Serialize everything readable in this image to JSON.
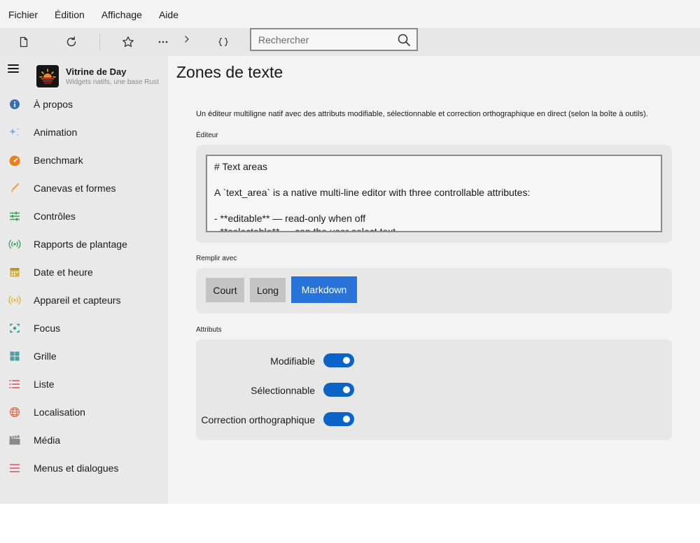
{
  "menubar": {
    "items": [
      "Fichier",
      "Édition",
      "Affichage",
      "Aide"
    ]
  },
  "toolbar": {
    "buttons": [
      "new-document-icon",
      "refresh-icon",
      "star-icon",
      "more-icon",
      "chevron-right-icon",
      "braces-icon"
    ],
    "search_placeholder": "Rechercher"
  },
  "sidebar": {
    "app_title": "Vitrine de Day",
    "app_subtitle": "Widgets natifs, une base Rust",
    "items": [
      {
        "label": "À propos",
        "icon": "info-icon",
        "color": "#3a6fb0"
      },
      {
        "label": "Animation",
        "icon": "sparkle-icon",
        "color": "#7fb3e6"
      },
      {
        "label": "Benchmark",
        "icon": "speedometer-icon",
        "color": "#f07d1a"
      },
      {
        "label": "Canevas et formes",
        "icon": "brush-icon",
        "color": "#f0a030"
      },
      {
        "label": "Contrôles",
        "icon": "sliders-icon",
        "color": "#3aa05a"
      },
      {
        "label": "Rapports de plantage",
        "icon": "broadcast-icon",
        "color": "#3aa05a"
      },
      {
        "label": "Date et heure",
        "icon": "calendar-icon",
        "color": "#d8b040"
      },
      {
        "label": "Appareil et capteurs",
        "icon": "sensor-icon",
        "color": "#e6b030"
      },
      {
        "label": "Focus",
        "icon": "focus-icon",
        "color": "#2a9a8a"
      },
      {
        "label": "Grille",
        "icon": "grid-icon",
        "color": "#4aa0a0"
      },
      {
        "label": "Liste",
        "icon": "list-icon",
        "color": "#e05050"
      },
      {
        "label": "Localisation",
        "icon": "globe-icon",
        "color": "#e07050"
      },
      {
        "label": "Média",
        "icon": "clapper-icon",
        "color": "#8a8a8a"
      },
      {
        "label": "Menus et dialogues",
        "icon": "menu-icon",
        "color": "#e05070"
      }
    ]
  },
  "main": {
    "title": "Zones de texte",
    "description": "Un éditeur multiligne natif avec des attributs modifiable, sélectionnable et correction orthographique en direct (selon la boîte à outils).",
    "editor_label": "Éditeur",
    "editor_lines": [
      "# Text areas",
      "",
      "A `text_area` is a native multi-line editor with three controllable attributes:",
      "",
      "- **editable** — read-only when off",
      "- **selectable** — can the user select text"
    ],
    "fill_label": "Remplir avec",
    "fill_buttons": {
      "short": "Court",
      "long": "Long",
      "markdown": "Markdown"
    },
    "attributes_label": "Attributs",
    "attributes": [
      {
        "label": "Modifiable",
        "on": true
      },
      {
        "label": "Sélectionnable",
        "on": true
      },
      {
        "label": "Correction orthographique",
        "on": true
      }
    ]
  }
}
